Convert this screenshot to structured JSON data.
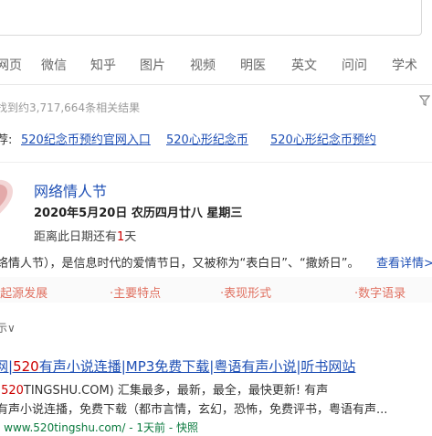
{
  "nav": {
    "items": [
      "网页",
      "微信",
      "知乎",
      "图片",
      "视频",
      "明医",
      "英文",
      "问问",
      "学术"
    ]
  },
  "results_info": {
    "count_text": "找到约3,717,664条相关结果"
  },
  "related": {
    "prefix": "荐:",
    "links": [
      "520纪念币预约官网入口",
      "520心形纪念币",
      "520心形纪念币预约"
    ]
  },
  "card": {
    "title": "网络情人节",
    "date": "2020年5月20日   农历四月廿八   星期三",
    "distance_prefix": "距离此日期还有",
    "distance_num": "1",
    "distance_suffix": "天",
    "description": "络情人节），是信息时代的爱情节日，又被称为“表白日”、“撒娇日”。",
    "more_link": "查看详情>",
    "tags": [
      "起源发展",
      "主要特点",
      "表现形式",
      "数字语录"
    ]
  },
  "toggle": {
    "label": "示∨"
  },
  "result": {
    "title_pre": "网|",
    "title_hl": "520",
    "title_post": "有声小说连播|MP3免费下载|粤语有声小说|听书网站",
    "line1_pre": "(",
    "line1_hl": "520",
    "line1_post": "TINGSHU.COM) 汇集最多，最新，最全，最快更新! 有声",
    "line2": "有声小说连播，免费下载（都市言情，玄幻，恐怖，免费评书，粤语有声...",
    "url": "- www.520tingshu.com/ - 1天前 - 快照"
  },
  "colors": {
    "link": "#1e4fb5",
    "highlight": "#c00000",
    "tag": "#e07060",
    "url": "#0a7a3e"
  }
}
